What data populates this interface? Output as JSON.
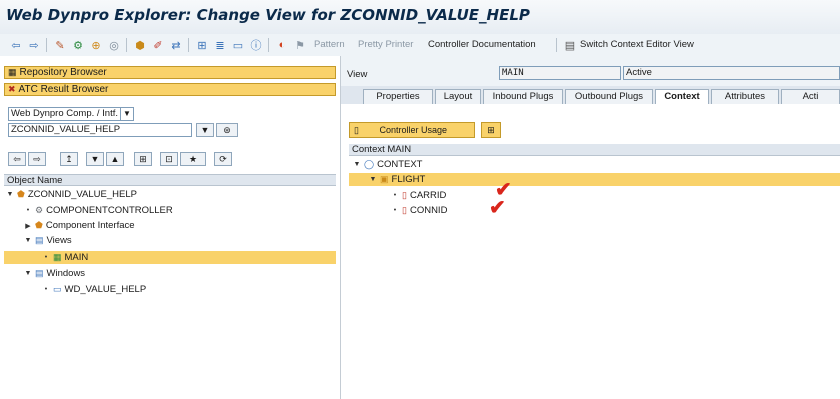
{
  "window": {
    "title": "Web Dynpro Explorer: Change View for ZCONNID_VALUE_HELP"
  },
  "toolbar": {
    "icons": [
      "back-icon",
      "forward-icon",
      "change-display-icon",
      "activate-icon",
      "check-object-icon",
      "where-used-icon",
      "other-object-icon",
      "edit-icon",
      "navigate-icon",
      "hierarchy-icon",
      "list-icon",
      "window-icon",
      "info-icon",
      "test-icon",
      "web-dynpro-icon"
    ],
    "pattern": "Pattern",
    "pretty_printer": "Pretty Printer",
    "controller_documentation": "Controller Documentation",
    "switch_context": "Switch Context Editor View"
  },
  "left": {
    "repository_browser": "Repository Browser",
    "atc_browser": "ATC Result Browser",
    "object_type": "Web Dynpro Comp. / Intf.",
    "object_name": "ZCONNID_VALUE_HELP",
    "tree_header": "Object Name",
    "tree": [
      {
        "label": "ZCONNID_VALUE_HELP",
        "depth": 0,
        "toggle": "▼",
        "icon": "component-icon"
      },
      {
        "label": "COMPONENTCONTROLLER",
        "depth": 1,
        "toggle": "•",
        "icon": "controller-icon"
      },
      {
        "label": "Component Interface",
        "depth": 1,
        "toggle": "▶",
        "icon": "interface-icon"
      },
      {
        "label": "Views",
        "depth": 1,
        "toggle": "▼",
        "icon": "views-folder-icon"
      },
      {
        "label": "MAIN",
        "depth": 2,
        "toggle": "•",
        "icon": "view-icon",
        "selected": true
      },
      {
        "label": "Windows",
        "depth": 1,
        "toggle": "▼",
        "icon": "windows-folder-icon"
      },
      {
        "label": "WD_VALUE_HELP",
        "depth": 2,
        "toggle": "•",
        "icon": "window-icon"
      }
    ]
  },
  "right": {
    "view_label": "View",
    "view_name": "MAIN",
    "status": "Active",
    "tabs": [
      "Properties",
      "Layout",
      "Inbound Plugs",
      "Outbound Plugs",
      "Context",
      "Attributes",
      "Acti"
    ],
    "active_tab": "Context",
    "controller_usage": "Controller Usage",
    "context_header": "Context MAIN",
    "context_tree": [
      {
        "label": "CONTEXT",
        "depth": 0,
        "toggle": "▼",
        "icon": "context-root-icon"
      },
      {
        "label": "FLIGHT",
        "depth": 1,
        "toggle": "▼",
        "icon": "node-icon",
        "selected": true
      },
      {
        "label": "CARRID",
        "depth": 2,
        "toggle": "•",
        "icon": "attribute-icon",
        "checked": true
      },
      {
        "label": "CONNID",
        "depth": 2,
        "toggle": "•",
        "icon": "attribute-icon",
        "checked": true
      }
    ]
  },
  "colors": {
    "selection": "#f9d26a",
    "checkmark": "#d9261c",
    "title": "#0b2a4a"
  }
}
